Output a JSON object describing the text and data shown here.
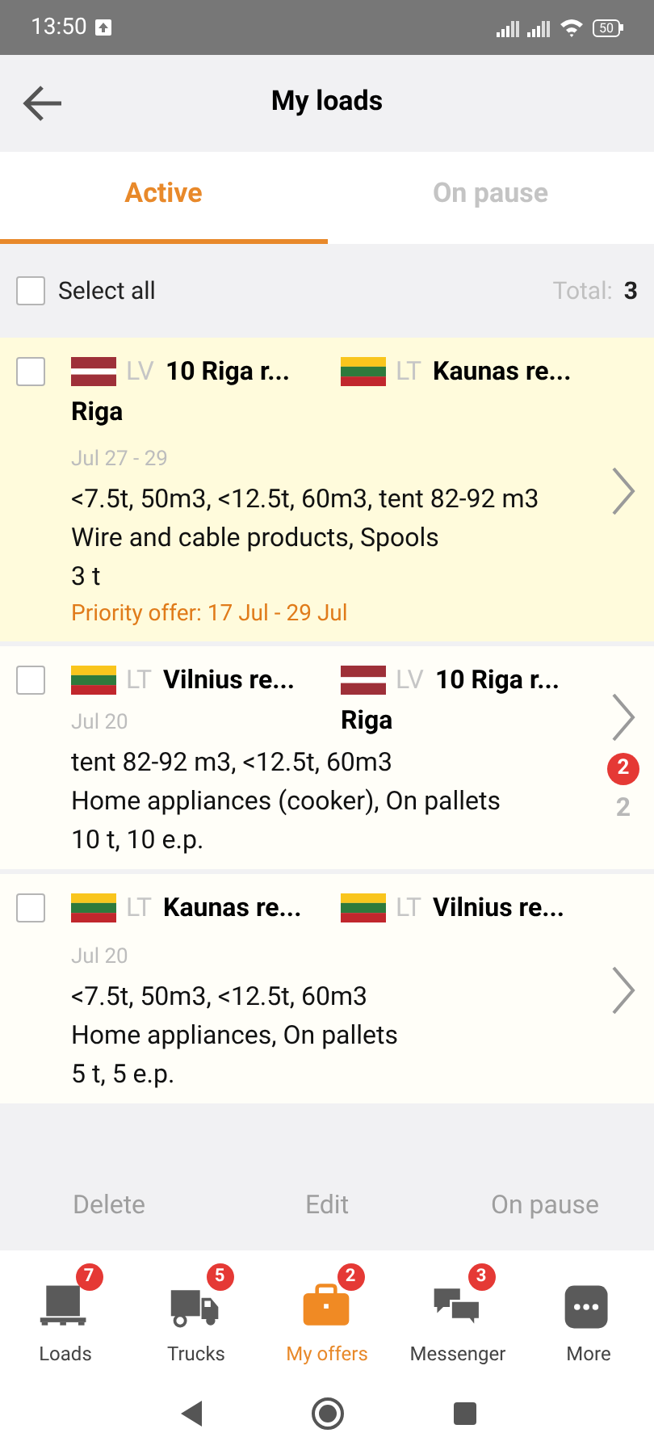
{
  "status_bar": {
    "time": "13:50",
    "battery": "50"
  },
  "header": {
    "title": "My loads"
  },
  "tabs": [
    {
      "label": "Active",
      "selected": true
    },
    {
      "label": "On pause",
      "selected": false
    }
  ],
  "select_all": {
    "label": "Select all",
    "checked": false
  },
  "total": {
    "label": "Total:",
    "value": "3"
  },
  "loads": [
    {
      "highlighted": true,
      "checked": false,
      "from": {
        "flag": {
          "kind": "lv"
        },
        "code": "LV",
        "name": "10 Riga r...",
        "line2": "Riga"
      },
      "to": {
        "flag": {
          "kind": "lt"
        },
        "code": "LT",
        "name": "Kaunas re..."
      },
      "date": "Jul 27 - 29",
      "specs": "<7.5t, 50m3, <12.5t, 60m3, tent 82-92 m3",
      "cargo": "Wire and cable products, Spools",
      "weight": "3 t",
      "priority": "Priority offer: 17 Jul  - 29 Jul"
    },
    {
      "highlighted": false,
      "checked": false,
      "from": {
        "flag": {
          "kind": "lt"
        },
        "code": "LT",
        "name": "Vilnius re..."
      },
      "to": {
        "flag": {
          "kind": "lv"
        },
        "code": "LV",
        "name": "10 Riga r...",
        "line2": "Riga"
      },
      "date": "Jul 20",
      "specs": "tent 82-92 m3, <12.5t, 60m3",
      "cargo": "Home appliances (cooker), On pallets",
      "weight": "10 t, 10 e.p.",
      "badge": "2",
      "count": "2"
    },
    {
      "highlighted": false,
      "checked": false,
      "from": {
        "flag": {
          "kind": "lt"
        },
        "code": "LT",
        "name": "Kaunas re..."
      },
      "to": {
        "flag": {
          "kind": "lt"
        },
        "code": "LT",
        "name": "Vilnius re..."
      },
      "date": "Jul 20",
      "specs": "<7.5t, 50m3, <12.5t, 60m3",
      "cargo": "Home appliances, On pallets",
      "weight": "5 t, 5 e.p."
    }
  ],
  "actions": [
    {
      "label": "Delete",
      "disabled": true
    },
    {
      "label": "Edit",
      "disabled": true
    },
    {
      "label": "On pause",
      "disabled": true
    }
  ],
  "bottom_nav": [
    {
      "kind": "loads",
      "label": "Loads",
      "badge": "7",
      "selected": false
    },
    {
      "kind": "trucks",
      "label": "Trucks",
      "badge": "5",
      "selected": false
    },
    {
      "kind": "offers",
      "label": "My offers",
      "badge": "2",
      "selected": true
    },
    {
      "kind": "messenger",
      "label": "Messenger",
      "badge": "3",
      "selected": false
    },
    {
      "kind": "more",
      "label": "More",
      "selected": false
    }
  ]
}
